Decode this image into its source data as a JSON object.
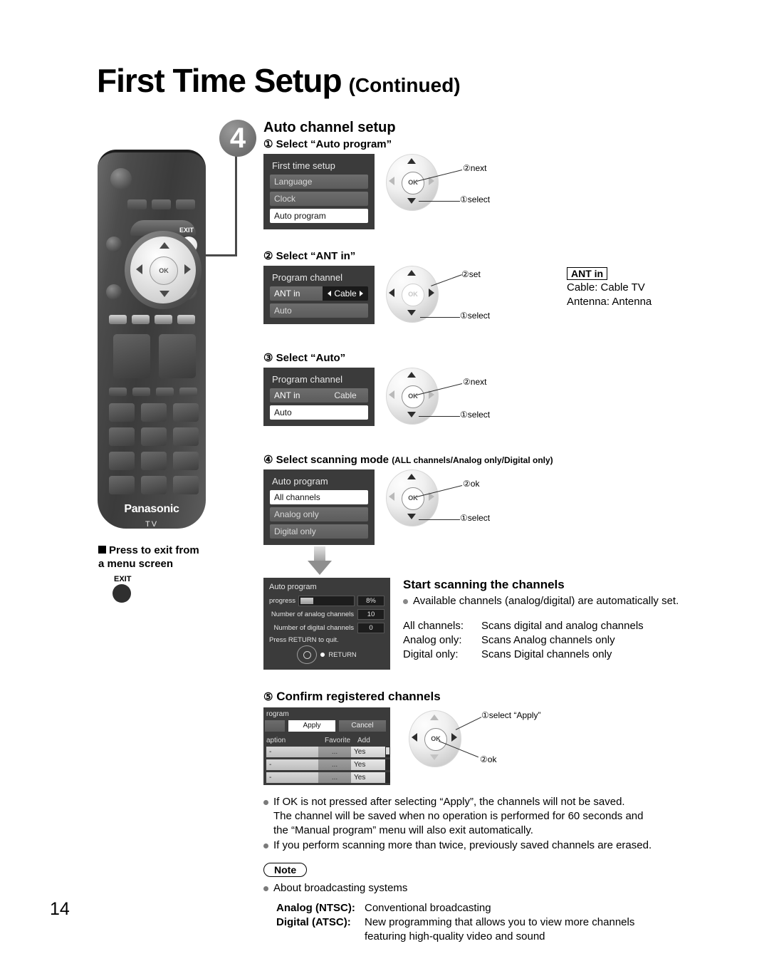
{
  "header": {
    "title_main": "First Time Setup",
    "title_sub": "(Continued)"
  },
  "step": {
    "badge": "4",
    "heading": "Auto channel setup"
  },
  "remote": {
    "brand": "Panasonic",
    "model_label": "TV",
    "exit_label": "EXIT",
    "ok_label": "OK"
  },
  "exit_note": {
    "heading_line1": "Press to exit from",
    "heading_line2": "a menu screen",
    "button_label": "EXIT"
  },
  "substeps": [
    {
      "number": "①",
      "title": "Select “Auto program”",
      "menu": {
        "title": "First time setup",
        "items": [
          {
            "label": "Language",
            "state": "dim"
          },
          {
            "label": "Clock",
            "state": "dim"
          },
          {
            "label": "Auto program",
            "state": "selected"
          }
        ]
      },
      "callouts": [
        {
          "num": "②",
          "text": "next"
        },
        {
          "num": "①",
          "text": "select"
        }
      ]
    },
    {
      "number": "②",
      "title": "Select “ANT in”",
      "menu": {
        "title": "Program channel",
        "row_label": "ANT in",
        "row_value": "Cable",
        "items": [
          {
            "label": "Auto",
            "state": "dim"
          }
        ]
      },
      "callouts": [
        {
          "num": "②",
          "text": "set"
        },
        {
          "num": "①",
          "text": "select"
        }
      ]
    },
    {
      "number": "③",
      "title": "Select “Auto”",
      "menu": {
        "title": "Program channel",
        "row_label": "ANT in",
        "row_value": "Cable",
        "items": [
          {
            "label": "Auto",
            "state": "selected"
          }
        ]
      },
      "callouts": [
        {
          "num": "②",
          "text": "next"
        },
        {
          "num": "①",
          "text": "select"
        }
      ]
    },
    {
      "number": "④",
      "title": "Select scanning mode",
      "title_suffix": "(ALL channels/Analog only/Digital only)",
      "menu": {
        "title": "Auto program",
        "items": [
          {
            "label": "All channels",
            "state": "selected"
          },
          {
            "label": "Analog only",
            "state": "dim"
          },
          {
            "label": "Digital only",
            "state": "dim"
          }
        ]
      },
      "callouts": [
        {
          "num": "②",
          "text": "ok"
        },
        {
          "num": "①",
          "text": "select"
        }
      ]
    },
    {
      "number": "⑤",
      "title": "Confirm registered channels",
      "callouts": [
        {
          "num": "①",
          "text": "select “Apply”"
        },
        {
          "num": "②",
          "text": "ok"
        }
      ]
    }
  ],
  "ant_in": {
    "badge": "ANT in",
    "lines": [
      "Cable:  Cable TV",
      "Antenna:  Antenna"
    ]
  },
  "scanning": {
    "heading": "Start scanning the channels",
    "bullet": "Available channels (analog/digital) are automatically set.",
    "modes": [
      {
        "name": "All channels:",
        "desc": "Scans digital and analog channels"
      },
      {
        "name": "Analog only:",
        "desc": "Scans Analog channels only"
      },
      {
        "name": "Digital only:",
        "desc": "Scans Digital channels only"
      }
    ]
  },
  "progress_dialog": {
    "title": "Auto program",
    "progress_label": "progress",
    "progress_value": "8%",
    "progress_percent": 8,
    "analog_label": "Number of analog channels",
    "analog_value": "10",
    "digital_label": "Number of digital channels",
    "digital_value": "0",
    "quit_text": "Press RETURN to quit.",
    "return_label": "RETURN"
  },
  "channel_dialog": {
    "title": "rogram",
    "apply": "Apply",
    "cancel": "Cancel",
    "headers": [
      "aption",
      "Favorite",
      "Add"
    ],
    "rows": [
      {
        "caption": "-",
        "favorite": "...",
        "add": "Yes"
      },
      {
        "caption": "-",
        "favorite": "...",
        "add": "Yes"
      },
      {
        "caption": "-",
        "favorite": "...",
        "add": "Yes"
      }
    ]
  },
  "bottom_notes": [
    "If OK is not pressed after selecting “Apply”, the channels will not be saved.",
    "The channel will be saved when no operation is performed for 60 seconds and",
    "the “Manual program” menu will also exit automatically.",
    "If you perform scanning more than twice, previously saved channels are erased."
  ],
  "note": {
    "pill": "Note",
    "bullet": "About broadcasting systems",
    "rows": [
      {
        "key": "Analog (NTSC):",
        "value": "Conventional broadcasting"
      },
      {
        "key": "Digital (ATSC):",
        "value": "New programming that allows you to view more channels"
      },
      {
        "key": "",
        "value": "featuring high-quality video and sound"
      }
    ]
  },
  "page_number": "14"
}
